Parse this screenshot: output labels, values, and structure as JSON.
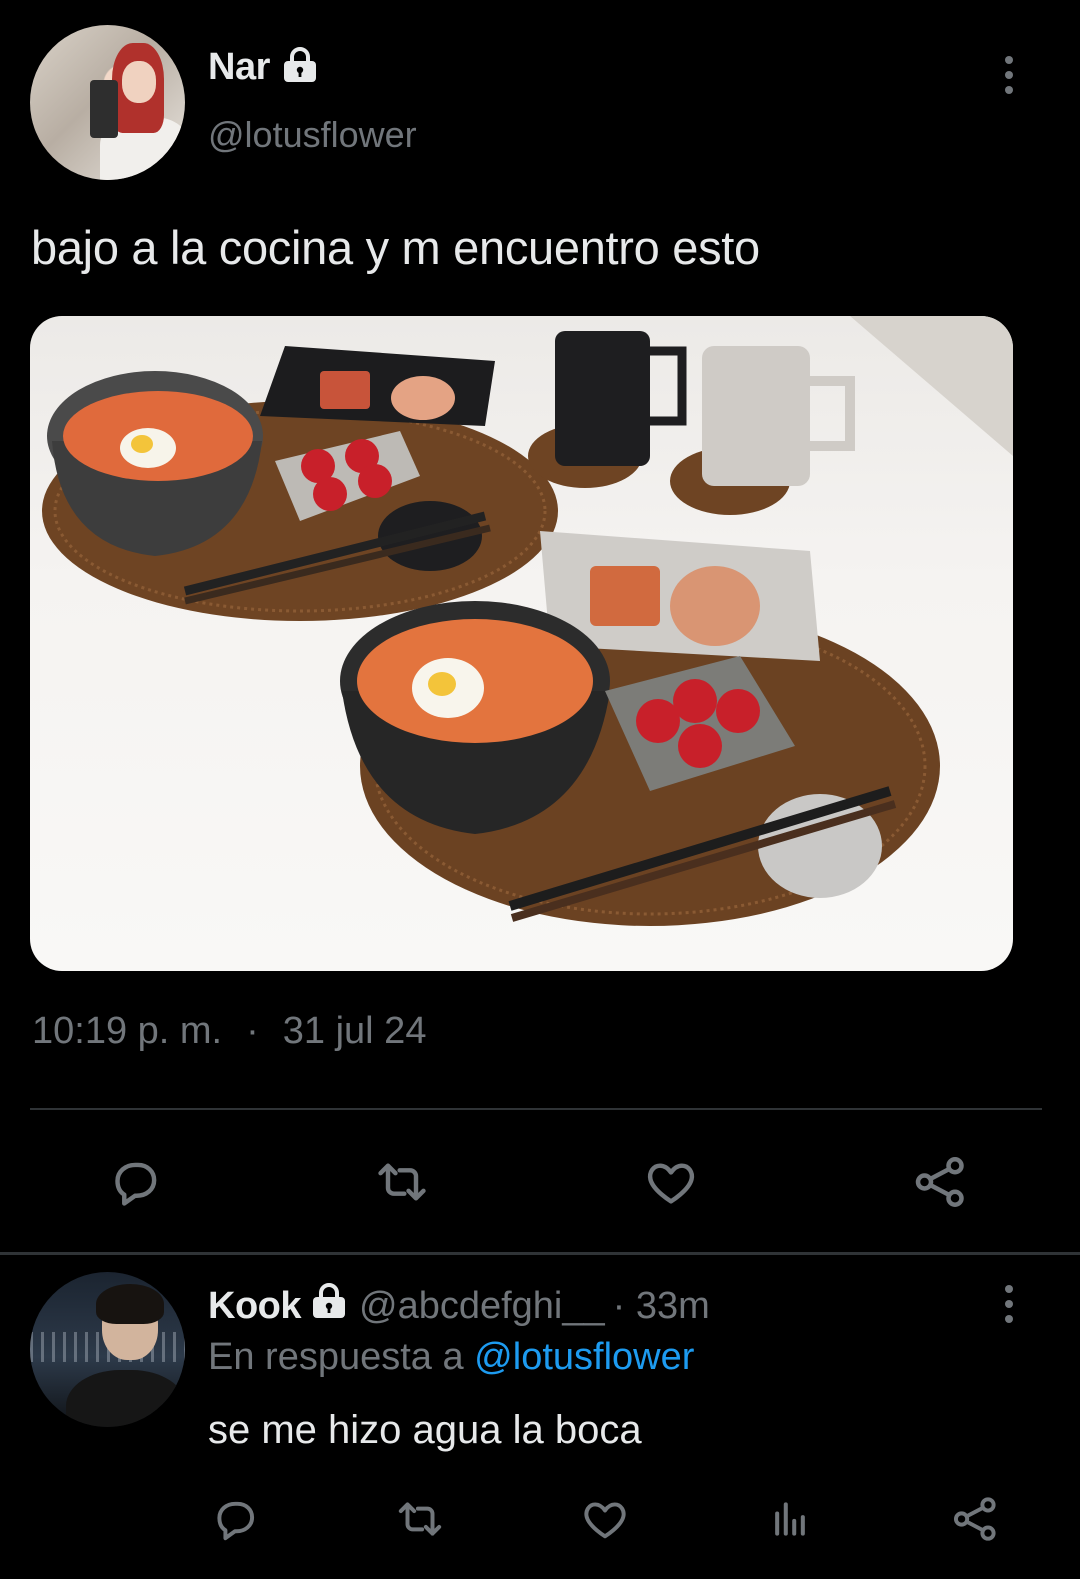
{
  "tweet": {
    "author": {
      "name": "Nar",
      "handle": "@lotusflower",
      "locked": true
    },
    "text": "bajo a la cocina y m encuentro esto",
    "time": "10:19 p. m.",
    "separator": "·",
    "date": "31 jul 24",
    "actions": [
      "reply-icon",
      "retweet-icon",
      "like-icon",
      "share-icon"
    ]
  },
  "reply": {
    "author": {
      "name": "Kook",
      "handle": "@abcdefghi__",
      "locked": true
    },
    "age": "· 33m",
    "in_reply_prefix": "En respuesta a",
    "in_reply_to": "@lotusflower",
    "text": "se me hizo agua la boca",
    "actions": [
      "reply-icon",
      "retweet-icon",
      "like-icon",
      "views-icon",
      "share-icon"
    ]
  },
  "colors": {
    "background": "#000000",
    "text": "#e7e9ea",
    "secondary": "#71767b",
    "link": "#1d9bf0",
    "divider": "#2f3336"
  }
}
